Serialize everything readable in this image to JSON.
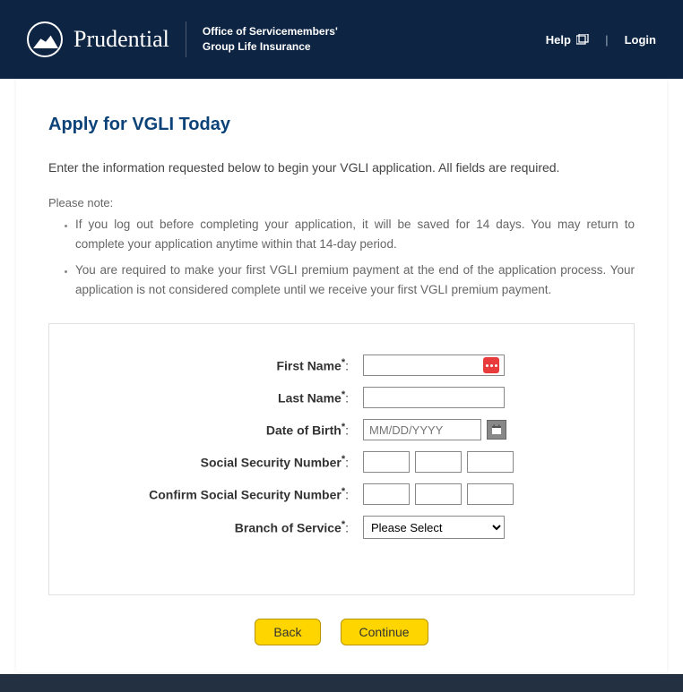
{
  "header": {
    "brand": "Prudential",
    "office_line1": "Office of Servicemembers'",
    "office_line2": "Group Life Insurance",
    "help": "Help",
    "login": "Login"
  },
  "page": {
    "title": "Apply for VGLI Today",
    "intro": "Enter the information requested below to begin your VGLI application. All fields are required.",
    "note_label": "Please note:",
    "notes": [
      "If you log out before completing your application, it will be saved for 14 days. You may return to complete your application anytime within that 14-day period.",
      "You are required to make your first VGLI premium payment at the end of the application process. Your application is not considered complete until we receive your first VGLI premium payment."
    ]
  },
  "form": {
    "first_name_label": "First Name",
    "last_name_label": "Last Name",
    "dob_label": "Date of Birth",
    "dob_placeholder": "MM/DD/YYYY",
    "ssn_label": "Social Security Number",
    "ssn_confirm_label": "Confirm Social Security Number",
    "branch_label": "Branch of Service",
    "branch_placeholder": "Please Select"
  },
  "buttons": {
    "back": "Back",
    "continue": "Continue"
  }
}
